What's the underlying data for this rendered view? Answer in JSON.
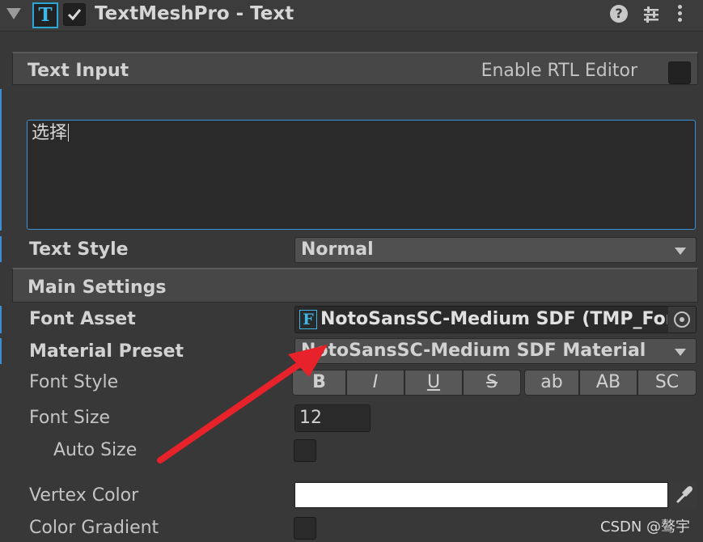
{
  "header": {
    "icon_letter": "T",
    "title": "TextMeshPro - Text"
  },
  "text_input": {
    "section_label": "Text Input",
    "rtl_label": "Enable RTL Editor",
    "value": "选择"
  },
  "text_style": {
    "label": "Text Style",
    "value": "Normal"
  },
  "main_settings": {
    "section_label": "Main Settings"
  },
  "font_asset": {
    "label": "Font Asset",
    "icon_letter": "F",
    "value": "NotoSansSC-Medium SDF (TMP_Font"
  },
  "material_preset": {
    "label": "Material Preset",
    "value": "NotoSansSC-Medium SDF Material"
  },
  "font_style": {
    "label": "Font Style",
    "buttons": [
      "B",
      "I",
      "U",
      "S",
      "ab",
      "AB",
      "SC"
    ]
  },
  "font_size": {
    "label": "Font Size",
    "value": "12"
  },
  "auto_size": {
    "label": "Auto Size",
    "checked": false
  },
  "vertex_color": {
    "label": "Vertex Color",
    "color": "#ffffff"
  },
  "color_gradient": {
    "label": "Color Gradient",
    "checked": false
  },
  "annotation": {
    "arrow_color": "#e8222a"
  },
  "watermark": "CSDN @骜宇"
}
